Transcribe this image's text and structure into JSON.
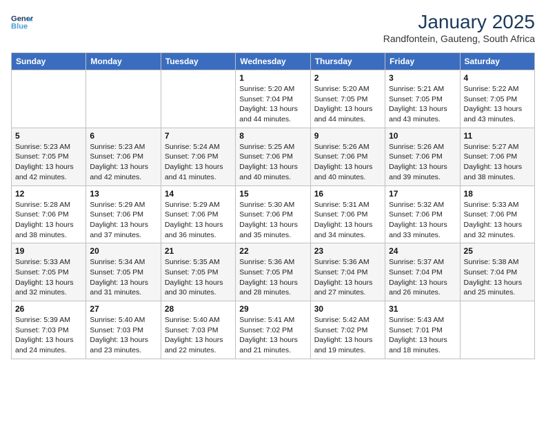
{
  "logo": {
    "line1": "General",
    "line2": "Blue"
  },
  "title": "January 2025",
  "subtitle": "Randfontein, Gauteng, South Africa",
  "days_of_week": [
    "Sunday",
    "Monday",
    "Tuesday",
    "Wednesday",
    "Thursday",
    "Friday",
    "Saturday"
  ],
  "weeks": [
    [
      {
        "day": "",
        "info": ""
      },
      {
        "day": "",
        "info": ""
      },
      {
        "day": "",
        "info": ""
      },
      {
        "day": "1",
        "info": "Sunrise: 5:20 AM\nSunset: 7:04 PM\nDaylight: 13 hours\nand 44 minutes."
      },
      {
        "day": "2",
        "info": "Sunrise: 5:20 AM\nSunset: 7:05 PM\nDaylight: 13 hours\nand 44 minutes."
      },
      {
        "day": "3",
        "info": "Sunrise: 5:21 AM\nSunset: 7:05 PM\nDaylight: 13 hours\nand 43 minutes."
      },
      {
        "day": "4",
        "info": "Sunrise: 5:22 AM\nSunset: 7:05 PM\nDaylight: 13 hours\nand 43 minutes."
      }
    ],
    [
      {
        "day": "5",
        "info": "Sunrise: 5:23 AM\nSunset: 7:05 PM\nDaylight: 13 hours\nand 42 minutes."
      },
      {
        "day": "6",
        "info": "Sunrise: 5:23 AM\nSunset: 7:06 PM\nDaylight: 13 hours\nand 42 minutes."
      },
      {
        "day": "7",
        "info": "Sunrise: 5:24 AM\nSunset: 7:06 PM\nDaylight: 13 hours\nand 41 minutes."
      },
      {
        "day": "8",
        "info": "Sunrise: 5:25 AM\nSunset: 7:06 PM\nDaylight: 13 hours\nand 40 minutes."
      },
      {
        "day": "9",
        "info": "Sunrise: 5:26 AM\nSunset: 7:06 PM\nDaylight: 13 hours\nand 40 minutes."
      },
      {
        "day": "10",
        "info": "Sunrise: 5:26 AM\nSunset: 7:06 PM\nDaylight: 13 hours\nand 39 minutes."
      },
      {
        "day": "11",
        "info": "Sunrise: 5:27 AM\nSunset: 7:06 PM\nDaylight: 13 hours\nand 38 minutes."
      }
    ],
    [
      {
        "day": "12",
        "info": "Sunrise: 5:28 AM\nSunset: 7:06 PM\nDaylight: 13 hours\nand 38 minutes."
      },
      {
        "day": "13",
        "info": "Sunrise: 5:29 AM\nSunset: 7:06 PM\nDaylight: 13 hours\nand 37 minutes."
      },
      {
        "day": "14",
        "info": "Sunrise: 5:29 AM\nSunset: 7:06 PM\nDaylight: 13 hours\nand 36 minutes."
      },
      {
        "day": "15",
        "info": "Sunrise: 5:30 AM\nSunset: 7:06 PM\nDaylight: 13 hours\nand 35 minutes."
      },
      {
        "day": "16",
        "info": "Sunrise: 5:31 AM\nSunset: 7:06 PM\nDaylight: 13 hours\nand 34 minutes."
      },
      {
        "day": "17",
        "info": "Sunrise: 5:32 AM\nSunset: 7:06 PM\nDaylight: 13 hours\nand 33 minutes."
      },
      {
        "day": "18",
        "info": "Sunrise: 5:33 AM\nSunset: 7:06 PM\nDaylight: 13 hours\nand 32 minutes."
      }
    ],
    [
      {
        "day": "19",
        "info": "Sunrise: 5:33 AM\nSunset: 7:05 PM\nDaylight: 13 hours\nand 32 minutes."
      },
      {
        "day": "20",
        "info": "Sunrise: 5:34 AM\nSunset: 7:05 PM\nDaylight: 13 hours\nand 31 minutes."
      },
      {
        "day": "21",
        "info": "Sunrise: 5:35 AM\nSunset: 7:05 PM\nDaylight: 13 hours\nand 30 minutes."
      },
      {
        "day": "22",
        "info": "Sunrise: 5:36 AM\nSunset: 7:05 PM\nDaylight: 13 hours\nand 28 minutes."
      },
      {
        "day": "23",
        "info": "Sunrise: 5:36 AM\nSunset: 7:04 PM\nDaylight: 13 hours\nand 27 minutes."
      },
      {
        "day": "24",
        "info": "Sunrise: 5:37 AM\nSunset: 7:04 PM\nDaylight: 13 hours\nand 26 minutes."
      },
      {
        "day": "25",
        "info": "Sunrise: 5:38 AM\nSunset: 7:04 PM\nDaylight: 13 hours\nand 25 minutes."
      }
    ],
    [
      {
        "day": "26",
        "info": "Sunrise: 5:39 AM\nSunset: 7:03 PM\nDaylight: 13 hours\nand 24 minutes."
      },
      {
        "day": "27",
        "info": "Sunrise: 5:40 AM\nSunset: 7:03 PM\nDaylight: 13 hours\nand 23 minutes."
      },
      {
        "day": "28",
        "info": "Sunrise: 5:40 AM\nSunset: 7:03 PM\nDaylight: 13 hours\nand 22 minutes."
      },
      {
        "day": "29",
        "info": "Sunrise: 5:41 AM\nSunset: 7:02 PM\nDaylight: 13 hours\nand 21 minutes."
      },
      {
        "day": "30",
        "info": "Sunrise: 5:42 AM\nSunset: 7:02 PM\nDaylight: 13 hours\nand 19 minutes."
      },
      {
        "day": "31",
        "info": "Sunrise: 5:43 AM\nSunset: 7:01 PM\nDaylight: 13 hours\nand 18 minutes."
      },
      {
        "day": "",
        "info": ""
      }
    ]
  ]
}
